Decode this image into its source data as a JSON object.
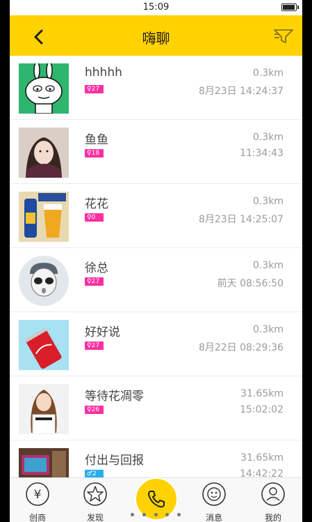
{
  "status_bar": {
    "time": "15:09"
  },
  "header": {
    "title": "嗨聊"
  },
  "contacts": [
    {
      "name": "hhhhh",
      "age": "27",
      "gender": "female",
      "distance": "0.3km",
      "time": "8月23日 14:24:37"
    },
    {
      "name": "鱼鱼",
      "age": "18",
      "gender": "female",
      "distance": "0.3km",
      "time": "11:34:43"
    },
    {
      "name": "花花",
      "age": "0",
      "gender": "female",
      "distance": "0.3km",
      "time": "8月23日 14:25:07"
    },
    {
      "name": "徐总",
      "age": "27",
      "gender": "female",
      "distance": "0.3km",
      "time": "前天 08:56:50"
    },
    {
      "name": "好好说",
      "age": "27",
      "gender": "female",
      "distance": "0.3km",
      "time": "8月22日 08:29:36"
    },
    {
      "name": "等待花凋零",
      "age": "26",
      "gender": "female",
      "distance": "31.65km",
      "time": "15:02:02"
    },
    {
      "name": "付出与回报",
      "age": "2",
      "gender": "male",
      "distance": "31.65km",
      "time": "14:42:22"
    }
  ],
  "tabbar": {
    "items": [
      {
        "label": "创商",
        "icon": "yuan-coin-icon"
      },
      {
        "label": "发现",
        "icon": "star-icon"
      },
      {
        "label": "",
        "icon": "phone-icon"
      },
      {
        "label": "消息",
        "icon": "message-face-icon"
      },
      {
        "label": "我的",
        "icon": "user-icon"
      }
    ]
  },
  "colors": {
    "accent": "#ffd200",
    "female_badge": "#ff2fa0",
    "male_badge": "#2aaeea"
  }
}
